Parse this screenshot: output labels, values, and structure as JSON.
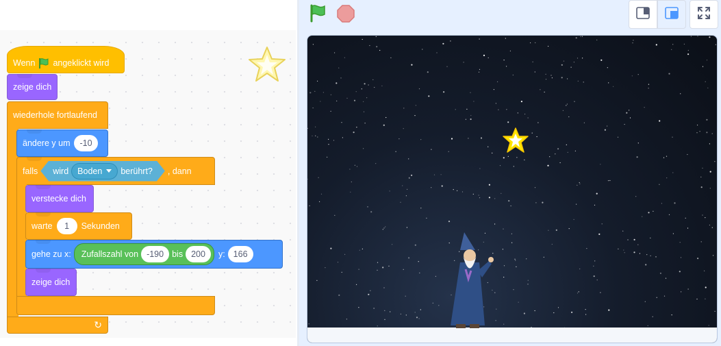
{
  "script": {
    "when_flag_pre": "Wenn",
    "when_flag_post": "angeklickt wird",
    "show1": "zeige dich",
    "forever": "wiederhole fortlaufend",
    "change_y": "ändere y um",
    "change_y_value": "-10",
    "if_label": "falls",
    "touching_pre": "wird",
    "touching_target": "Boden",
    "touching_post": "berührt?",
    "then_label": ", dann",
    "hide": "verstecke dich",
    "wait_pre": "warte",
    "wait_value": "1",
    "wait_post": "Sekunden",
    "goto_pre": "gehe zu x:",
    "random_pre": "Zufallszahl von",
    "random_from": "-190",
    "random_mid": "bis",
    "random_to": "200",
    "goto_y": "y:",
    "goto_y_value": "166",
    "show2": "zeige dich"
  },
  "toolbar": {
    "green_flag_icon": "green-flag-icon",
    "stop_icon": "stop-sign-icon",
    "small_stage_icon": "small-stage-icon",
    "normal_stage_icon": "normal-stage-icon",
    "fullscreen_icon": "fullscreen-icon",
    "selected_layout": "normal-stage"
  },
  "colors": {
    "events": "#ffbf00",
    "looks": "#9966ff",
    "control": "#ffab19",
    "motion": "#4c97ff",
    "operators": "#59c059",
    "sensing": "#5cb1d6",
    "accent": "#4c97ff"
  },
  "stage": {
    "sprites": [
      "star",
      "wizard"
    ],
    "backdrop": "night-sky"
  }
}
